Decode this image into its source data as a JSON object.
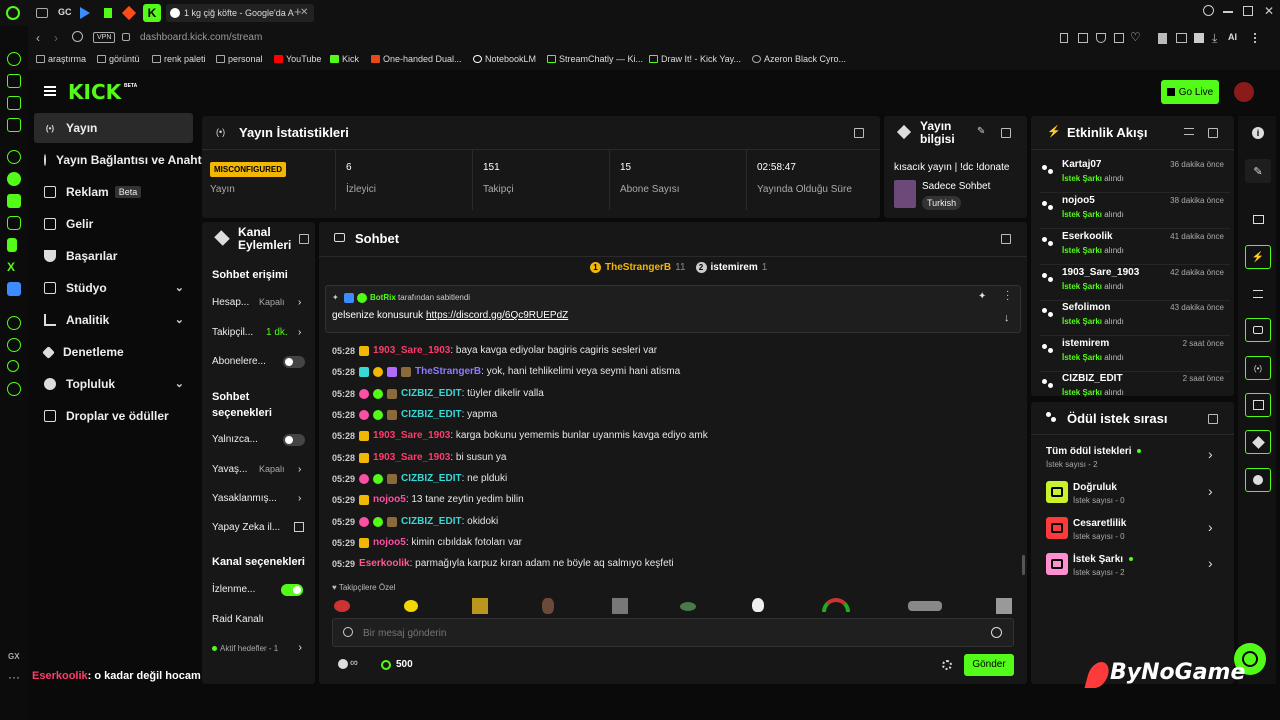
{
  "browser": {
    "tab_title": "1 kg çiğ köfte - Google'da A",
    "gc_label": "GC",
    "url": "dashboard.kick.com/stream",
    "vpn_label": "VPN",
    "ai_label": "AI",
    "gx_label": "GX",
    "bookmarks": [
      "araştırma",
      "görüntü",
      "renk paleti",
      "personal",
      "YouTube",
      "Kick",
      "One-handed Dual...",
      "NotebookLM",
      "StreamChatly — Ki...",
      "Draw It! - Kick Yay...",
      "Azeron Black Cyro..."
    ]
  },
  "kick": {
    "logo": "KICK",
    "logo_tag": "BETA",
    "go_live": "Go Live",
    "nav": [
      {
        "label": "Yayın",
        "icon": "broadcast-icon"
      },
      {
        "label": "Yayın Bağlantısı ve Anahtar",
        "icon": "link-icon"
      },
      {
        "label": "Reklam",
        "icon": "ad-icon",
        "badge": "Beta"
      },
      {
        "label": "Gelir",
        "icon": "revenue-icon"
      },
      {
        "label": "Başarılar",
        "icon": "trophy-icon"
      },
      {
        "label": "Stüdyo",
        "icon": "studio-icon"
      },
      {
        "label": "Analitik",
        "icon": "analytics-icon"
      },
      {
        "label": "Denetleme",
        "icon": "moderation-icon"
      },
      {
        "label": "Topluluk",
        "icon": "community-icon"
      },
      {
        "label": "Droplar ve ödüller",
        "icon": "drops-icon"
      }
    ]
  },
  "stats": {
    "title": "Yayın İstatistikleri",
    "status_badge": "MISCONFIGURED",
    "status_label": "Yayın",
    "items": [
      {
        "value": "6",
        "label": "İzleyici"
      },
      {
        "value": "151",
        "label": "Takipçi"
      },
      {
        "value": "15",
        "label": "Abone Sayısı"
      },
      {
        "value": "02:58:47",
        "label": "Yayında Olduğu Süre"
      }
    ]
  },
  "stream_info": {
    "title_line1": "Yayın",
    "title_line2": "bilgisi",
    "stream_title": "kısacık yayın | !dc !donate",
    "category": "Sadece Sohbet",
    "language": "Turkish"
  },
  "channel_actions": {
    "title_line1": "Kanal",
    "title_line2": "Eylemleri",
    "chat_access": "Sohbet erişimi",
    "rows": [
      {
        "label": "Hesap...",
        "value": "Kapalı"
      },
      {
        "label": "Takipçil...",
        "value": "1 dk."
      },
      {
        "label": "Abonelere..."
      }
    ],
    "chat_options_1": "Sohbet",
    "chat_options_2": "seçenekleri",
    "rows2": [
      {
        "label": "Yalnızca..."
      },
      {
        "label": "Yavaş...",
        "value": "Kapalı"
      },
      {
        "label": "Yasaklanmış..."
      },
      {
        "label": "Yapay Zeka il..."
      }
    ],
    "channel_options": "Kanal seçenekleri",
    "rows3": [
      {
        "label": "İzlenme..."
      },
      {
        "label": "Raid Kanalı"
      }
    ],
    "active_goals": "Aktif hedefler - 1"
  },
  "chat": {
    "title": "Sohbet",
    "top_users": [
      {
        "rank": "1",
        "name": "TheStrangerB",
        "count": "11"
      },
      {
        "rank": "2",
        "name": "istemirem",
        "count": "1"
      }
    ],
    "pinned_by": "BotRix",
    "pinned_suffix": "tarafından sabitlendi",
    "pinned_text": "gelsenize konusuruk",
    "pinned_link": "https://discord.gg/6Qc9RUEPdZ",
    "messages": [
      {
        "time": "05:28",
        "user": "1903_Sare_1903",
        "color": "#ff3b6b",
        "text": ": baya kavga ediyolar bagiris cagiris sesleri var"
      },
      {
        "time": "05:28",
        "user": "TheStrangerB",
        "color": "#8b7cff",
        "text": ": yok, hani tehlikelimi veya seymi hani atisma"
      },
      {
        "time": "05:28",
        "user": "CIZBIZ_EDIT",
        "color": "#3ad7d7",
        "text": ": tüyler dikelir valla"
      },
      {
        "time": "05:28",
        "user": "CIZBIZ_EDIT",
        "color": "#3ad7d7",
        "text": ": yapma"
      },
      {
        "time": "05:28",
        "user": "1903_Sare_1903",
        "color": "#ff3b6b",
        "text": ": karga bokunu yememis bunlar uyanmis kavga ediyo amk"
      },
      {
        "time": "05:28",
        "user": "1903_Sare_1903",
        "color": "#ff3b6b",
        "text": ": bi susun ya"
      },
      {
        "time": "05:29",
        "user": "CIZBIZ_EDIT",
        "color": "#3ad7d7",
        "text": ": ne plduki"
      },
      {
        "time": "05:29",
        "user": "nojoo5",
        "color": "#ff4fa3",
        "text": ": 13 tane zeytin yedim bilin"
      },
      {
        "time": "05:29",
        "user": "CIZBIZ_EDIT",
        "color": "#3ad7d7",
        "text": ": okidoki"
      },
      {
        "time": "05:29",
        "user": "nojoo5",
        "color": "#ff4fa3",
        "text": ": kimin cıbıldak fotoları var"
      },
      {
        "time": "05:29",
        "user": "Eserkoolik",
        "color": "#ff5b8c",
        "text": ": parmağıyla karpuz kıran adam ne böyle aq salmıyo keşfeti"
      }
    ],
    "followers_only_label": "Takipçilere Özel",
    "input_placeholder": "Bir mesaj gönderin",
    "points": "500",
    "send": "Gönder"
  },
  "activity": {
    "title": "Etkinlik Akışı",
    "items": [
      {
        "name": "Kartaj07",
        "action": "İstek Şarkı",
        "suffix": "alındı",
        "time": "36 dakika önce"
      },
      {
        "name": "nojoo5",
        "action": "İstek Şarkı",
        "suffix": "alındı",
        "time": "38 dakika önce"
      },
      {
        "name": "Eserkoolik",
        "action": "İstek Şarkı",
        "suffix": "alındı",
        "time": "41 dakika önce"
      },
      {
        "name": "1903_Sare_1903",
        "action": "İstek Şarkı",
        "suffix": "alındı",
        "time": "42 dakika önce"
      },
      {
        "name": "Sefolimon",
        "action": "İstek Şarkı",
        "suffix": "alındı",
        "time": "43 dakika önce"
      },
      {
        "name": "istemirem",
        "action": "İstek Şarkı",
        "suffix": "alındı",
        "time": "2 saat önce"
      },
      {
        "name": "CIZBIZ_EDIT",
        "action": "İstek Şarkı",
        "suffix": "alındı",
        "time": "2 saat önce"
      }
    ]
  },
  "rewards": {
    "title": "Ödül istek sırası",
    "all_label": "Tüm ödül istekleri",
    "all_count": "İstek sayısı - 2",
    "items": [
      {
        "name": "Doğruluk",
        "count": "İstek sayısı - 0",
        "color": "#c8f22c"
      },
      {
        "name": "Cesaretlilik",
        "count": "İstek sayısı - 0",
        "color": "#ff3a3a"
      },
      {
        "name": "İstek Şarkı",
        "count": "İstek sayısı - 2",
        "color": "#ff8fd0"
      }
    ]
  },
  "overlay": {
    "user": "Eserkoolik",
    "text": ": o kadar değil hocam",
    "watermark": "ByNoGame"
  },
  "colors": {
    "accent": "#53fc18",
    "panel": "#171717",
    "bg": "#0b0b0b"
  }
}
